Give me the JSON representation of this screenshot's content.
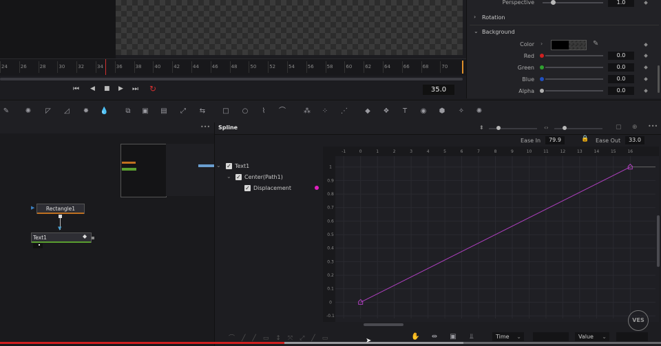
{
  "inspector": {
    "perspective_label": "Perspective",
    "perspective_value": "1.0",
    "rotation_label": "Rotation",
    "background_label": "Background",
    "color_label": "Color",
    "red_label": "Red",
    "red_value": "0.0",
    "green_label": "Green",
    "green_value": "0.0",
    "blue_label": "Blue",
    "blue_value": "0.0",
    "alpha_label": "Alpha",
    "alpha_value": "0.0"
  },
  "timeline": {
    "ticks": [
      "24",
      "26",
      "28",
      "30",
      "32",
      "34",
      "36",
      "38",
      "40",
      "42",
      "44",
      "46",
      "48",
      "50",
      "52",
      "54",
      "56",
      "58",
      "60",
      "62",
      "64",
      "66",
      "68",
      "70"
    ],
    "current_frame": "35.0"
  },
  "spline": {
    "title": "Spline",
    "ease_in_label": "Ease In",
    "ease_in_value": "79.9",
    "ease_out_label": "Ease Out",
    "ease_out_value": "33.0",
    "tree": {
      "text1": "Text1",
      "center_path": "Center(Path1)",
      "displacement": "Displacement"
    },
    "footer_time": "Time",
    "footer_value": "Value"
  },
  "nodes": {
    "rectangle": "Rectangle1",
    "text": "Text1"
  },
  "watermark": "VES",
  "colors": {
    "accent_red": "#d23030",
    "curve": "#b040c0",
    "displacement_dot": "#e020c0"
  },
  "chart_data": {
    "type": "line",
    "x_ticks": [
      "-1",
      "0",
      "1",
      "2",
      "3",
      "4",
      "5",
      "6",
      "7",
      "8",
      "9",
      "10",
      "11",
      "12",
      "13",
      "14",
      "15",
      "16"
    ],
    "y_ticks": [
      "1",
      "0.9",
      "0.8",
      "0.7",
      "0.6",
      "0.5",
      "0.4",
      "0.3",
      "0.2",
      "0.1",
      "0",
      "-0.1"
    ],
    "xlim": [
      -1.5,
      17.5
    ],
    "ylim": [
      -0.12,
      1.08
    ],
    "series": [
      {
        "x": [
          0,
          16
        ],
        "y": [
          0,
          1
        ]
      }
    ],
    "grid": true
  }
}
